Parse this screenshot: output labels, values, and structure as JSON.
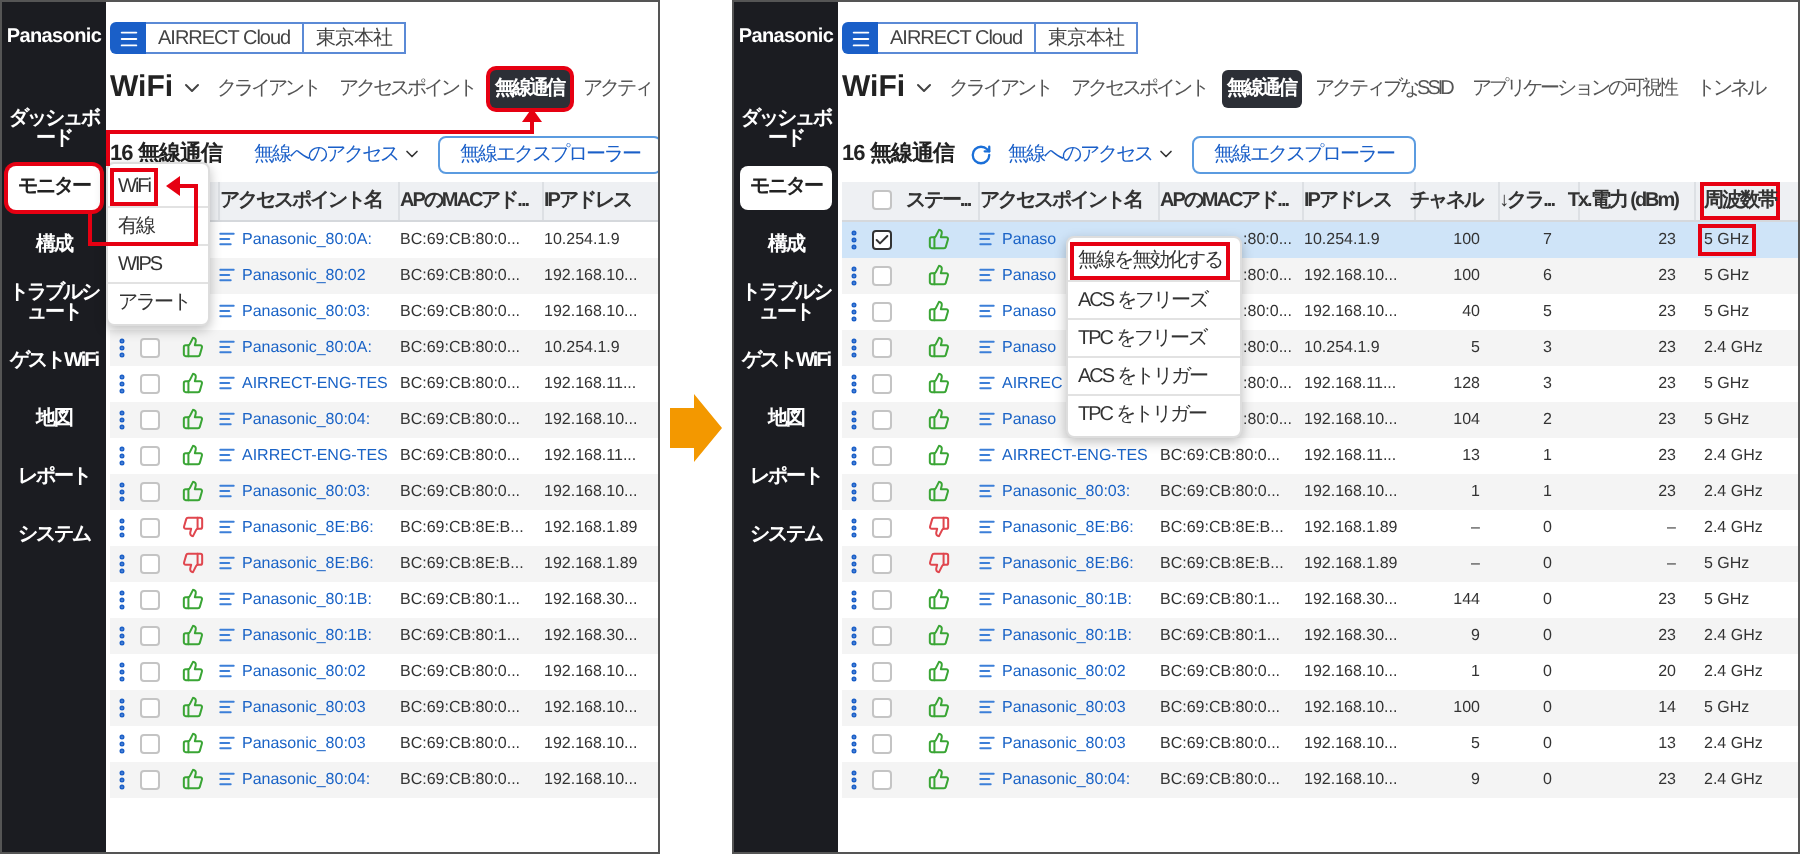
{
  "panels": [
    {
      "sidebar": {
        "logo": "Panasonic",
        "items": [
          {
            "label": "ダッシュボード",
            "selected": false,
            "callout": false
          },
          {
            "label": "モニター",
            "selected": true,
            "callout": true
          },
          {
            "label": "構成",
            "selected": false,
            "callout": false
          },
          {
            "label": "トラブルシュート",
            "selected": false,
            "callout": false
          },
          {
            "label": "ゲストWiFi",
            "selected": false,
            "callout": false
          },
          {
            "label": "地図",
            "selected": false,
            "callout": false
          },
          {
            "label": "レポート",
            "selected": false,
            "callout": false
          },
          {
            "label": "システム",
            "selected": false,
            "callout": false
          }
        ]
      },
      "breadcrumb": [
        "AIRRECT Cloud",
        "東京本社"
      ],
      "title": "WiFi",
      "tabs": [
        {
          "label": "クライアント",
          "selected": false,
          "callout": false
        },
        {
          "label": "アクセスポイント",
          "selected": false,
          "callout": false
        },
        {
          "label": "無線通信",
          "selected": true,
          "callout": true
        },
        {
          "label": "アクティ",
          "selected": false,
          "callout": false
        }
      ],
      "toolbar": {
        "count": "16 無線通信",
        "access": "無線へのアクセス",
        "explorer": "無線エクスプローラー"
      },
      "table": {
        "columns": [
          {
            "kind": "status"
          },
          {
            "kind": "name",
            "label": "アクセスポイント名"
          },
          {
            "kind": "mac",
            "label": "APのMACアド..."
          },
          {
            "kind": "ip",
            "label": "IPアドレス"
          }
        ],
        "rows": [
          {
            "name": "Panasonic_80:0A:",
            "mac": "BC:69:CB:80:0...",
            "ip": "10.254.1.9"
          },
          {
            "name": "Panasonic_80:02",
            "mac": "BC:69:CB:80:0...",
            "ip": "192.168.10..."
          },
          {
            "name": "Panasonic_80:03:",
            "mac": "BC:69:CB:80:0...",
            "ip": "192.168.10..."
          },
          {
            "checked": false,
            "thumbs_up": true,
            "name": "Panasonic_80:0A:",
            "mac": "BC:69:CB:80:0...",
            "ip": "10.254.1.9"
          },
          {
            "checked": false,
            "thumbs_up": true,
            "name": "AIRRECT-ENG-TES",
            "mac": "BC:69:CB:80:0...",
            "ip": "192.168.11..."
          },
          {
            "checked": false,
            "thumbs_up": true,
            "name": "Panasonic_80:04:",
            "mac": "BC:69:CB:80:0...",
            "ip": "192.168.10..."
          },
          {
            "checked": false,
            "thumbs_up": true,
            "name": "AIRRECT-ENG-TES",
            "mac": "BC:69:CB:80:0...",
            "ip": "192.168.11..."
          },
          {
            "checked": false,
            "thumbs_up": true,
            "name": "Panasonic_80:03:",
            "mac": "BC:69:CB:80:0...",
            "ip": "192.168.10..."
          },
          {
            "checked": false,
            "thumbs_up": false,
            "name": "Panasonic_8E:B6:",
            "mac": "BC:69:CB:8E:B...",
            "ip": "192.168.1.89"
          },
          {
            "checked": false,
            "thumbs_up": false,
            "name": "Panasonic_8E:B6:",
            "mac": "BC:69:CB:8E:B...",
            "ip": "192.168.1.89"
          },
          {
            "checked": false,
            "thumbs_up": true,
            "name": "Panasonic_80:1B:",
            "mac": "BC:69:CB:80:1...",
            "ip": "192.168.30..."
          },
          {
            "checked": false,
            "thumbs_up": true,
            "name": "Panasonic_80:1B:",
            "mac": "BC:69:CB:80:1...",
            "ip": "192.168.30..."
          },
          {
            "checked": false,
            "thumbs_up": true,
            "name": "Panasonic_80:02",
            "mac": "BC:69:CB:80:0...",
            "ip": "192.168.10..."
          },
          {
            "checked": false,
            "thumbs_up": true,
            "name": "Panasonic_80:03",
            "mac": "BC:69:CB:80:0...",
            "ip": "192.168.10..."
          },
          {
            "checked": false,
            "thumbs_up": true,
            "name": "Panasonic_80:03",
            "mac": "BC:69:CB:80:0...",
            "ip": "192.168.10..."
          },
          {
            "checked": false,
            "thumbs_up": true,
            "name": "Panasonic_80:04:",
            "mac": "BC:69:CB:80:0...",
            "ip": "192.168.10..."
          }
        ]
      },
      "menu": {
        "kind": "dropdown",
        "items": [
          {
            "label": "WiFi",
            "callout": true
          },
          {
            "label": "有線",
            "callout": false
          },
          {
            "label": "WIPS",
            "callout": false
          },
          {
            "label": "アラート",
            "callout": false
          }
        ]
      }
    },
    {
      "sidebar": {
        "logo": "Panasonic",
        "items": [
          {
            "label": "ダッシュボード",
            "selected": false,
            "callout": false
          },
          {
            "label": "モニター",
            "selected": true,
            "callout": false
          },
          {
            "label": "構成",
            "selected": false,
            "callout": false
          },
          {
            "label": "トラブルシュート",
            "selected": false,
            "callout": false
          },
          {
            "label": "ゲストWiFi",
            "selected": false,
            "callout": false
          },
          {
            "label": "地図",
            "selected": false,
            "callout": false
          },
          {
            "label": "レポート",
            "selected": false,
            "callout": false
          },
          {
            "label": "システム",
            "selected": false,
            "callout": false
          }
        ]
      },
      "breadcrumb": [
        "AIRRECT Cloud",
        "東京本社"
      ],
      "title": "WiFi",
      "tabs": [
        {
          "label": "クライアント",
          "selected": false,
          "callout": false
        },
        {
          "label": "アクセスポイント",
          "selected": false,
          "callout": false
        },
        {
          "label": "無線通信",
          "selected": true,
          "callout": false
        },
        {
          "label": "アクティブなSSID",
          "selected": false,
          "callout": false
        },
        {
          "label": "アプリケーションの可視性",
          "selected": false,
          "callout": false
        },
        {
          "label": "トンネル",
          "selected": false,
          "callout": false
        }
      ],
      "toolbar": {
        "count": "16 無線通信",
        "access": "無線へのアクセス",
        "explorer": "無線エクスプローラー"
      },
      "table": {
        "header_checkbox": {
          "checked": false
        },
        "columns": [
          {
            "kind": "status",
            "label": "ステー..."
          },
          {
            "kind": "name",
            "label": "アクセスポイント名"
          },
          {
            "kind": "mac",
            "label": "APのMACアド..."
          },
          {
            "kind": "ip",
            "label": "IPアドレス"
          },
          {
            "kind": "channel",
            "label": "チャネル"
          },
          {
            "kind": "clients",
            "label": "↓クラ..."
          },
          {
            "kind": "tx",
            "label": "Tx.電力 (dBm)"
          },
          {
            "kind": "band",
            "label": "周波数帯",
            "callout": true
          }
        ],
        "rows": [
          {
            "selected": true,
            "checked": true,
            "thumbs_up": true,
            "name": "Panaso",
            "mac": ":80:0...",
            "partly_hidden": true,
            "ip": "10.254.1.9",
            "channel": "100",
            "clients": "7",
            "tx": "23",
            "band": "5 GHz",
            "band_callout": true
          },
          {
            "selected": false,
            "checked": false,
            "thumbs_up": true,
            "name": "Panaso",
            "mac": ":80:0...",
            "partly_hidden": true,
            "ip": "192.168.10...",
            "channel": "100",
            "clients": "6",
            "tx": "23",
            "band": "5 GHz"
          },
          {
            "selected": false,
            "checked": false,
            "thumbs_up": true,
            "name": "Panaso",
            "mac": ":80:0...",
            "partly_hidden": true,
            "ip": "192.168.10...",
            "channel": "40",
            "clients": "5",
            "tx": "23",
            "band": "5 GHz"
          },
          {
            "selected": false,
            "checked": false,
            "thumbs_up": true,
            "name": "Panaso",
            "mac": ":80:0...",
            "partly_hidden": true,
            "ip": "10.254.1.9",
            "channel": "5",
            "clients": "3",
            "tx": "23",
            "band": "2.4 GHz"
          },
          {
            "selected": false,
            "checked": false,
            "thumbs_up": true,
            "name": "AIRREC",
            "mac": ":80:0...",
            "partly_hidden": true,
            "ip": "192.168.11...",
            "channel": "128",
            "clients": "3",
            "tx": "23",
            "band": "5 GHz"
          },
          {
            "selected": false,
            "checked": false,
            "thumbs_up": true,
            "name": "Panaso",
            "mac": ":80:0...",
            "partly_hidden": true,
            "ip": "192.168.10...",
            "channel": "104",
            "clients": "2",
            "tx": "23",
            "band": "5 GHz"
          },
          {
            "selected": false,
            "checked": false,
            "thumbs_up": true,
            "name": "AIRRECT-ENG-TES",
            "mac": "BC:69:CB:80:0...",
            "ip": "192.168.11...",
            "channel": "13",
            "clients": "1",
            "tx": "23",
            "band": "2.4 GHz"
          },
          {
            "selected": false,
            "checked": false,
            "thumbs_up": true,
            "name": "Panasonic_80:03:",
            "mac": "BC:69:CB:80:0...",
            "ip": "192.168.10...",
            "channel": "1",
            "clients": "1",
            "tx": "23",
            "band": "2.4 GHz"
          },
          {
            "selected": false,
            "checked": false,
            "thumbs_up": false,
            "name": "Panasonic_8E:B6:",
            "mac": "BC:69:CB:8E:B...",
            "ip": "192.168.1.89",
            "channel": "–",
            "clients": "0",
            "tx": "–",
            "band": "2.4 GHz"
          },
          {
            "selected": false,
            "checked": false,
            "thumbs_up": false,
            "name": "Panasonic_8E:B6:",
            "mac": "BC:69:CB:8E:B...",
            "ip": "192.168.1.89",
            "channel": "–",
            "clients": "0",
            "tx": "–",
            "band": "5 GHz"
          },
          {
            "selected": false,
            "checked": false,
            "thumbs_up": true,
            "name": "Panasonic_80:1B:",
            "mac": "BC:69:CB:80:1...",
            "ip": "192.168.30...",
            "channel": "144",
            "clients": "0",
            "tx": "23",
            "band": "5 GHz"
          },
          {
            "selected": false,
            "checked": false,
            "thumbs_up": true,
            "name": "Panasonic_80:1B:",
            "mac": "BC:69:CB:80:1...",
            "ip": "192.168.30...",
            "channel": "9",
            "clients": "0",
            "tx": "23",
            "band": "2.4 GHz"
          },
          {
            "selected": false,
            "checked": false,
            "thumbs_up": true,
            "name": "Panasonic_80:02",
            "mac": "BC:69:CB:80:0...",
            "ip": "192.168.10...",
            "channel": "1",
            "clients": "0",
            "tx": "20",
            "band": "2.4 GHz"
          },
          {
            "selected": false,
            "checked": false,
            "thumbs_up": true,
            "name": "Panasonic_80:03",
            "mac": "BC:69:CB:80:0...",
            "ip": "192.168.10...",
            "channel": "100",
            "clients": "0",
            "tx": "14",
            "band": "5 GHz"
          },
          {
            "selected": false,
            "checked": false,
            "thumbs_up": true,
            "name": "Panasonic_80:03",
            "mac": "BC:69:CB:80:0...",
            "ip": "192.168.10...",
            "channel": "5",
            "clients": "0",
            "tx": "13",
            "band": "2.4 GHz"
          },
          {
            "selected": false,
            "checked": false,
            "thumbs_up": true,
            "name": "Panasonic_80:04:",
            "mac": "BC:69:CB:80:0...",
            "ip": "192.168.10...",
            "channel": "9",
            "clients": "0",
            "tx": "23",
            "band": "2.4 GHz"
          }
        ]
      },
      "menu": {
        "kind": "context",
        "items": [
          {
            "label": "無線を無効化する",
            "callout": true
          },
          {
            "label": "ACS をフリーズ",
            "callout": false
          },
          {
            "label": "TPC をフリーズ",
            "callout": false
          },
          {
            "label": "ACS をトリガー",
            "callout": false
          },
          {
            "label": "TPC をトリガー",
            "callout": false
          }
        ]
      }
    }
  ]
}
